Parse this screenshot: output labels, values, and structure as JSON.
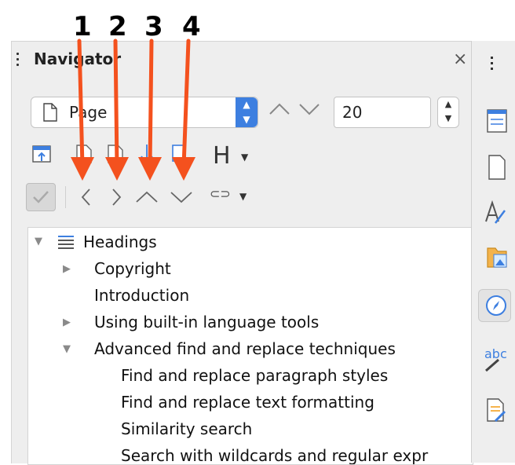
{
  "annotations": {
    "labels": [
      "1",
      "2",
      "3",
      "4"
    ],
    "arrow_color": "#f4511e"
  },
  "navigator": {
    "title": "Navigator",
    "close_glyph": "×",
    "navigate_by": "Page",
    "page_number": "20",
    "heading_button": "H"
  },
  "tree": {
    "root": "Headings",
    "items": [
      {
        "label": "Copyright",
        "level": 1,
        "expander": "collapsed"
      },
      {
        "label": "Introduction",
        "level": 1,
        "expander": "none"
      },
      {
        "label": "Using built-in language tools",
        "level": 1,
        "expander": "collapsed"
      },
      {
        "label": "Advanced find and replace techniques",
        "level": 1,
        "expander": "expanded"
      },
      {
        "label": "Find and replace paragraph styles",
        "level": 2,
        "expander": "none"
      },
      {
        "label": "Find and replace text formatting",
        "level": 2,
        "expander": "none"
      },
      {
        "label": "Similarity search",
        "level": 2,
        "expander": "none"
      },
      {
        "label": "Search with wildcards and regular expr",
        "level": 2,
        "expander": "none"
      }
    ]
  },
  "sidebar": {
    "items": [
      "properties-icon",
      "page-icon",
      "styles-icon",
      "gallery-icon",
      "navigator-icon",
      "manage-changes-icon",
      "design-icon"
    ]
  },
  "colors": {
    "accent": "#3d7fe0",
    "arrow": "#f4511e"
  }
}
